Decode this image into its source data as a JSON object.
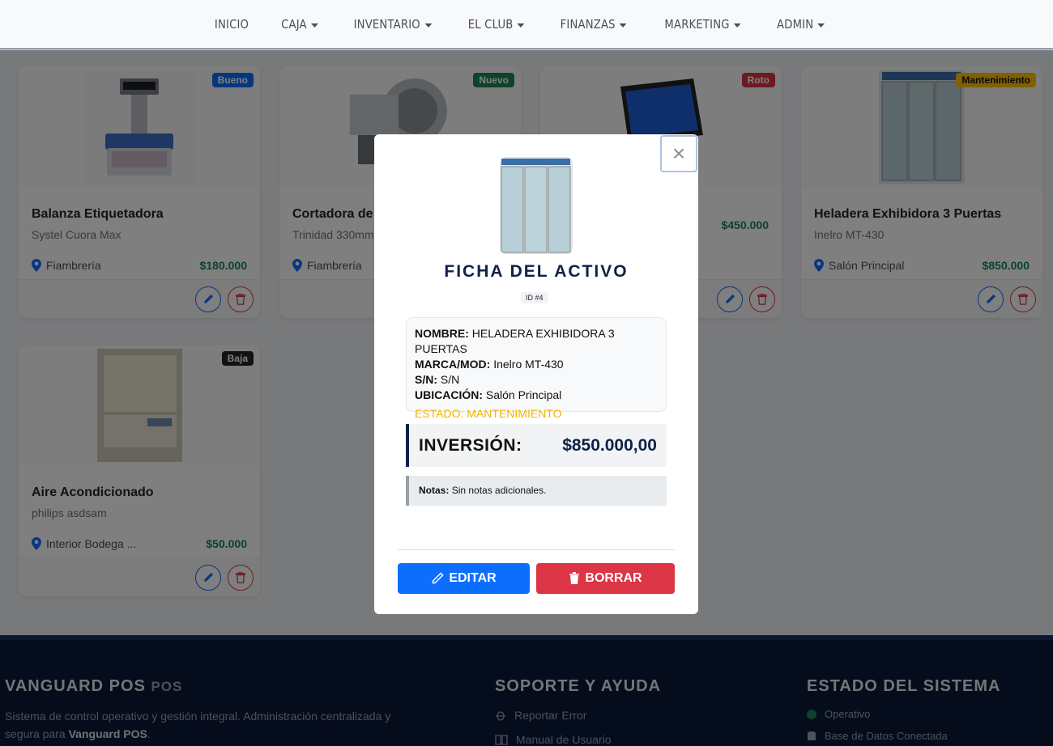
{
  "nav": {
    "items": [
      {
        "label": "INICIO",
        "dropdown": false
      },
      {
        "label": "CAJA",
        "dropdown": true
      },
      {
        "label": "INVENTARIO",
        "dropdown": true
      },
      {
        "label": "EL CLUB",
        "dropdown": true
      },
      {
        "label": "FINANZAS",
        "dropdown": true
      },
      {
        "label": "MARKETING",
        "dropdown": true
      },
      {
        "label": "ADMIN",
        "dropdown": true
      }
    ]
  },
  "assets": [
    {
      "title": "Balanza Etiquetadora",
      "model": "Systel Cuora Max",
      "location": "Fiambrería",
      "price": "$180.000",
      "badge": "Bueno",
      "badge_color": "#0d6efd"
    },
    {
      "title": "Cortadora de Fiambre",
      "model": "Trinidad 330mm",
      "location": "Fiambrería",
      "price": "",
      "badge": "Nuevo",
      "badge_color": "#198754"
    },
    {
      "title": "",
      "model": "",
      "location": "",
      "price": "$450.000",
      "badge": "Roto",
      "badge_color": "#dc3545"
    },
    {
      "title": "Heladera Exhibidora 3 Puertas",
      "model": "Inelro MT-430",
      "location": "Salón Principal",
      "price": "$850.000",
      "badge": "Mantenimiento",
      "badge_color": "#ffc107"
    },
    {
      "title": "Aire Acondicionado",
      "model": "philips asdsam",
      "location": "Interior Bodega ...",
      "price": "$50.000",
      "badge": "Baja",
      "badge_color": "#212529"
    }
  ],
  "modal": {
    "title": "FICHA DEL ACTIVO",
    "id_label": "ID #4",
    "fields": {
      "nombre_label": "NOMBRE:",
      "nombre": "HELADERA EXHIBIDORA 3 PUERTAS",
      "marca_label": "MARCA/MOD:",
      "marca": "Inelro MT-430",
      "sn_label": "S/N:",
      "sn": "S/N",
      "ubicacion_label": "UBICACIÓN:",
      "ubicacion": "Salón Principal",
      "estado": "ESTADO: MANTENIMIENTO"
    },
    "investment_label": "INVERSIÓN:",
    "investment_value": "$850.000,00",
    "notes_label": "Notas:",
    "notes_value": "Sin notas adicionales.",
    "edit_label": "EDITAR",
    "delete_label": "BORRAR",
    "close_symbol": "×"
  },
  "footer": {
    "brand": "VANGUARD POS",
    "brand_suffix": "POS",
    "description_1": "Sistema de control operativo y gestión integral. Administración centralizada y",
    "description_2_prefix": "segura para ",
    "description_2_bold": "Vanguard POS",
    "description_2_suffix": ".",
    "support_title": "SOPORTE Y AYUDA",
    "support_links": [
      "Reportar Error",
      "Manual de Usuario"
    ],
    "status_title": "ESTADO DEL SISTEMA",
    "status_items": [
      "Operativo",
      "Base de Datos Conectada"
    ]
  },
  "colors": {
    "navy": "#0d2246",
    "primary": "#0d6efd",
    "danger": "#dc3545",
    "success": "#198754",
    "warning": "#ffc107"
  }
}
